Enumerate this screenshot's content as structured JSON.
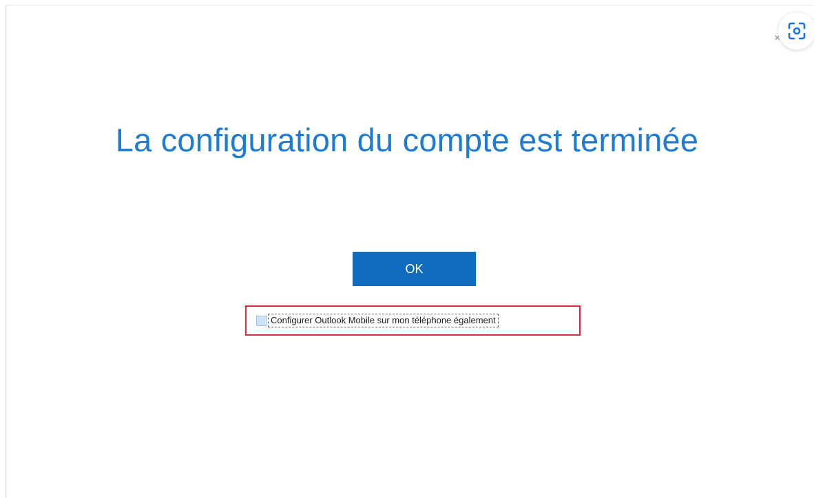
{
  "dialog": {
    "title": "La configuration du compte est terminée",
    "ok_label": "OK",
    "close_label": "×",
    "checkbox": {
      "label": "Configurer Outlook Mobile sur mon téléphone également",
      "checked": false
    }
  },
  "overlay": {
    "lens_icon": "visual-search-icon"
  },
  "colors": {
    "title": "#1e7bd3",
    "ok_button": "#0f6cbd",
    "highlight_box": "#e0283c",
    "checkbox_fill": "#cfe3f6"
  }
}
